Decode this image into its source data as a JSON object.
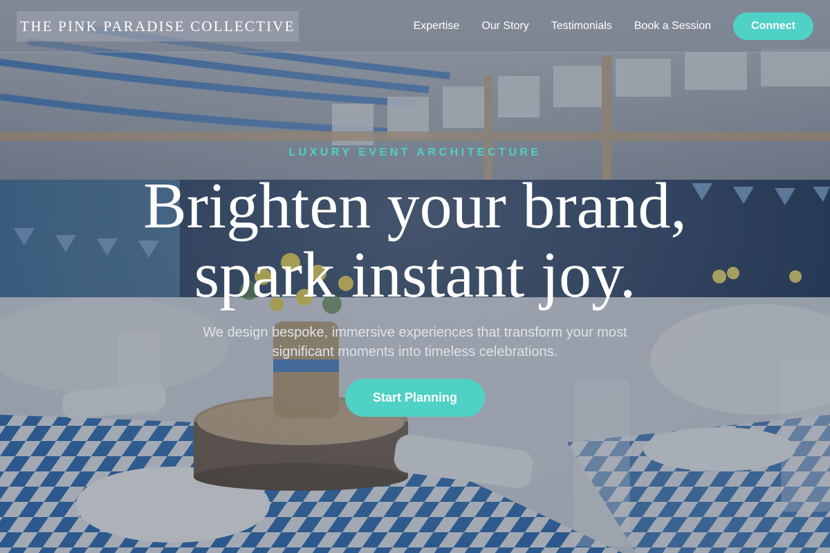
{
  "brand": {
    "name": "THE PINK PARADISE COLLECTIVE"
  },
  "nav": {
    "links": [
      "Expertise",
      "Our Story",
      "Testimonials",
      "Book a Session"
    ],
    "cta_label": "Connect"
  },
  "hero": {
    "eyebrow": "LUXURY EVENT ARCHITECTURE",
    "headline_line1": "Brighten your brand,",
    "headline_line2": "spark instant joy.",
    "subtext": "We design bespoke, immersive experiences that transform your most significant moments into timeless celebrations.",
    "cta_label": "Start Planning",
    "background_image": "banquet-hall-photo"
  },
  "colors": {
    "accent": "#4fd1c5",
    "overlay": "#283448",
    "text": "#ffffff"
  }
}
